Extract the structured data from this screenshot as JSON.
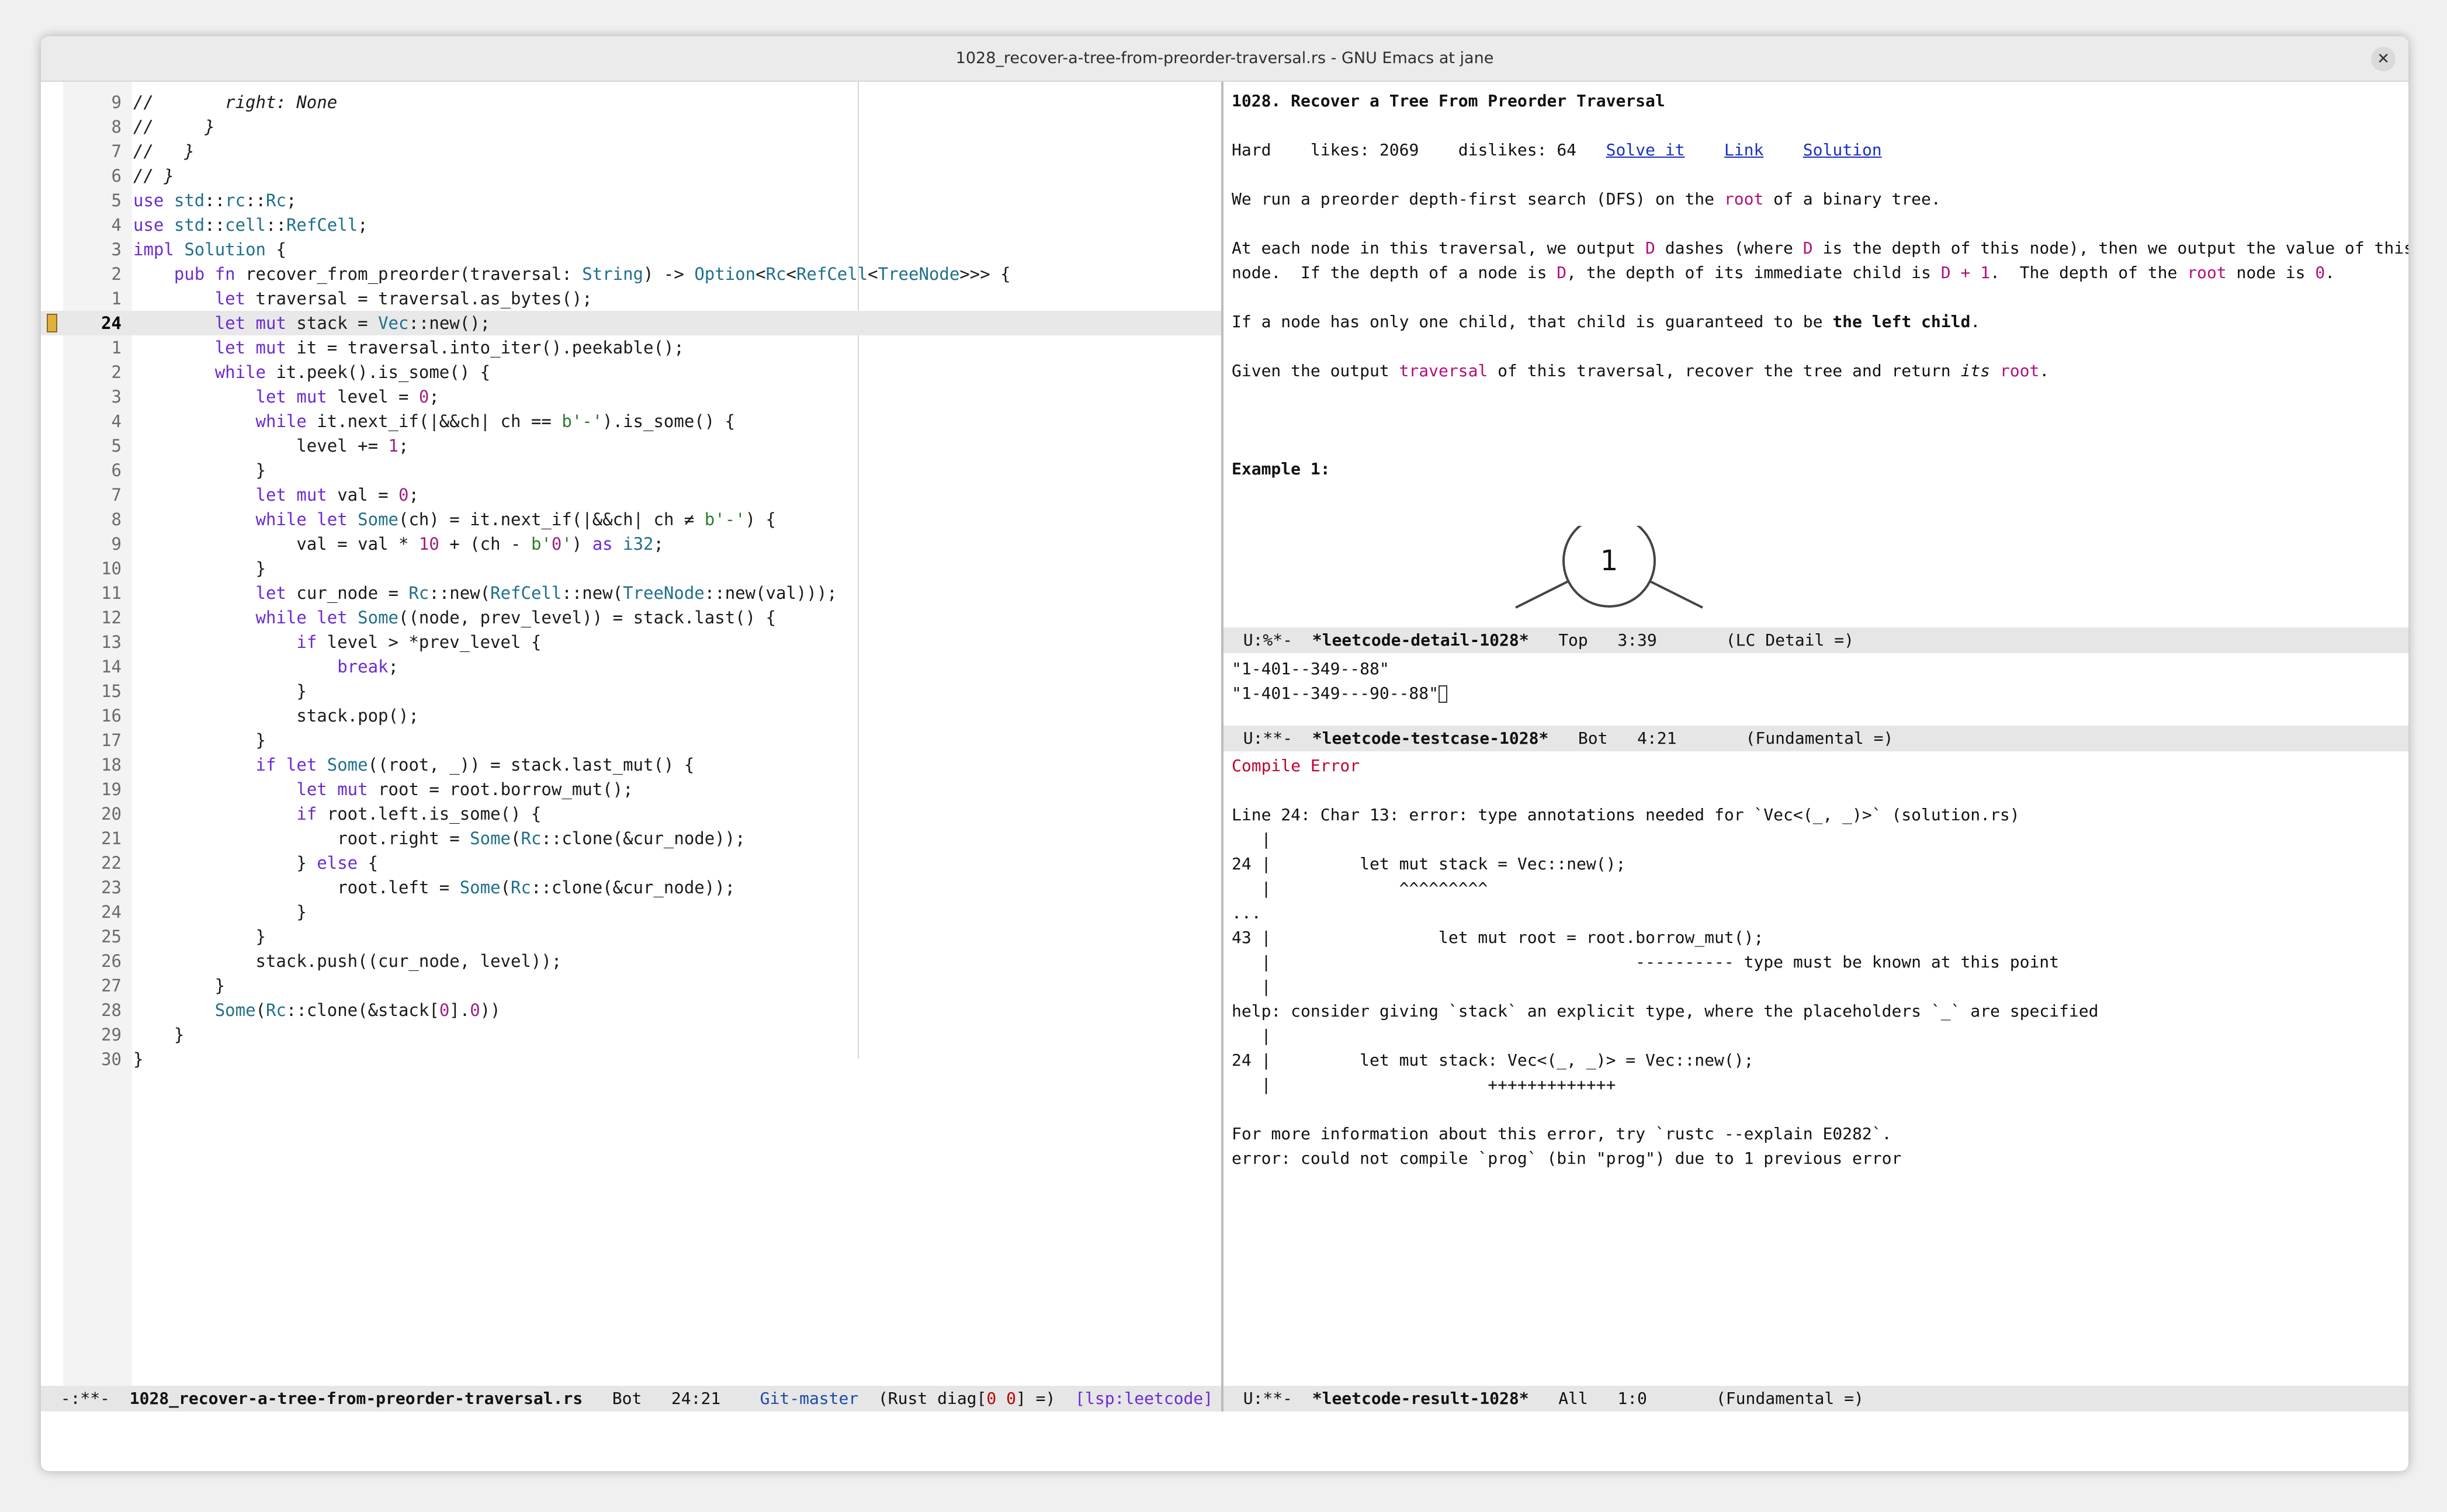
{
  "window": {
    "title": "1028_recover-a-tree-from-preorder-traversal.rs - GNU Emacs at jane",
    "close_glyph": "✕"
  },
  "editor": {
    "lines": [
      {
        "n": "9",
        "t": "//       right: None"
      },
      {
        "n": "8",
        "t": "//     }"
      },
      {
        "n": "7",
        "t": "//   }"
      },
      {
        "n": "6",
        "t": "// }"
      },
      {
        "n": "5",
        "t": "use std::rc::Rc;"
      },
      {
        "n": "4",
        "t": "use std::cell::RefCell;"
      },
      {
        "n": "3",
        "t": "impl Solution {"
      },
      {
        "n": "2",
        "t": "    pub fn recover_from_preorder(traversal: String) -> Option<Rc<RefCell<TreeNode>>> {"
      },
      {
        "n": "1",
        "t": "        let traversal = traversal.as_bytes();"
      },
      {
        "n": "24",
        "t": "        let mut stack = Vec::new();"
      },
      {
        "n": "1",
        "t": "        let mut it = traversal.into_iter().peekable();"
      },
      {
        "n": "2",
        "t": "        while it.peek().is_some() {"
      },
      {
        "n": "3",
        "t": "            let mut level = 0;"
      },
      {
        "n": "4",
        "t": "            while it.next_if(|&&ch| ch == b'-').is_some() {"
      },
      {
        "n": "5",
        "t": "                level += 1;"
      },
      {
        "n": "6",
        "t": "            }"
      },
      {
        "n": "7",
        "t": "            let mut val = 0;"
      },
      {
        "n": "8",
        "t": "            while let Some(ch) = it.next_if(|&&ch| ch ≠ b'-') {"
      },
      {
        "n": "9",
        "t": "                val = val * 10 + (ch - b'0') as i32;"
      },
      {
        "n": "10",
        "t": "            }"
      },
      {
        "n": "11",
        "t": "            let cur_node = Rc::new(RefCell::new(TreeNode::new(val)));"
      },
      {
        "n": "12",
        "t": "            while let Some((node, prev_level)) = stack.last() {"
      },
      {
        "n": "13",
        "t": "                if level > *prev_level {"
      },
      {
        "n": "14",
        "t": "                    break;"
      },
      {
        "n": "15",
        "t": "                }"
      },
      {
        "n": "16",
        "t": "                stack.pop();"
      },
      {
        "n": "17",
        "t": "            }"
      },
      {
        "n": "18",
        "t": "            if let Some((root, _)) = stack.last_mut() {"
      },
      {
        "n": "19",
        "t": "                let mut root = root.borrow_mut();"
      },
      {
        "n": "20",
        "t": "                if root.left.is_some() {"
      },
      {
        "n": "21",
        "t": "                    root.right = Some(Rc::clone(&cur_node));"
      },
      {
        "n": "22",
        "t": "                } else {"
      },
      {
        "n": "23",
        "t": "                    root.left = Some(Rc::clone(&cur_node));"
      },
      {
        "n": "24",
        "t": "                }"
      },
      {
        "n": "25",
        "t": "            }"
      },
      {
        "n": "26",
        "t": "            stack.push((cur_node, level));"
      },
      {
        "n": "27",
        "t": "        }"
      },
      {
        "n": "28",
        "t": "        Some(Rc::clone(&stack[0].0))"
      },
      {
        "n": "29",
        "t": "    }"
      },
      {
        "n": "30",
        "t": "}"
      }
    ],
    "modeline": {
      "status": "-:**-",
      "filename": "1028_recover-a-tree-from-preorder-traversal.rs",
      "pos": "Bot",
      "line_col": "24:21",
      "git": "Git-master",
      "mode_pre": "(Rust diag[",
      "diag_a": "0",
      "diag_b": "0",
      "mode_post": "] =)",
      "lsp": "[lsp:leetcode]"
    }
  },
  "detail": {
    "title": "1028. Recover a Tree From Preorder Traversal",
    "difficulty": "Hard",
    "likes": "likes: 2069",
    "dislikes": "dislikes: 64",
    "solve": "Solve it",
    "link": "Link",
    "solution": "Solution",
    "p1_a": "We run a preorder depth-first search (DFS) on the ",
    "p1_root": "root",
    "p1_b": " of a binary tree.",
    "p2_a": "At each node in this traversal, we output ",
    "p2_d1": "D",
    "p2_b": " dashes (where ",
    "p2_d2": "D",
    "p2_c": " is the depth of this node), then we output the value of this",
    "p3_a": "node.  If the depth of a node is ",
    "p3_d": "D",
    "p3_b": ", the depth of its immediate child is ",
    "p3_d1": "D + 1",
    "p3_c": ".  The depth of the ",
    "p3_root": "root",
    "p3_e": " node is ",
    "p3_zero": "0",
    "p3_f": ".",
    "p4_a": "If a node has only one child, that child is guaranteed to be ",
    "p4_b": "the left child",
    "p4_c": ".",
    "p5_a": "Given the output ",
    "p5_trav": "traversal",
    "p5_b": " of this traversal, recover the tree and return ",
    "p5_its": "its",
    "p5_sp": " ",
    "p5_root": "root",
    "p5_c": ".",
    "example": "Example 1:",
    "tree_node": "1",
    "modeline": {
      "status": "U:%*-",
      "name": "*leetcode-detail-1028*",
      "pos": "Top",
      "line_col": "3:39",
      "mode": "(LC Detail =)"
    }
  },
  "testcase": {
    "lines": [
      "\"1-401--349--88\"",
      "\"1-401--349---90--88\""
    ],
    "modeline": {
      "status": "U:**-",
      "name": "*leetcode-testcase-1028*",
      "pos": "Bot",
      "line_col": "4:21",
      "mode": "(Fundamental =)"
    }
  },
  "result": {
    "heading": "Compile Error",
    "lines": [
      "Line 24: Char 13: error: type annotations needed for `Vec<(_, _)>` (solution.rs)",
      "   |",
      "24 |         let mut stack = Vec::new();",
      "   |             ^^^^^^^^^",
      "...",
      "43 |                 let mut root = root.borrow_mut();",
      "   |                                     ---------- type must be known at this point",
      "   |",
      "help: consider giving `stack` an explicit type, where the placeholders `_` are specified",
      "   |",
      "24 |         let mut stack: Vec<(_, _)> = Vec::new();",
      "   |                      +++++++++++++",
      "",
      "For more information about this error, try `rustc --explain E0282`.",
      "error: could not compile `prog` (bin \"prog\") due to 1 previous error"
    ],
    "modeline": {
      "status": "U:**-",
      "name": "*leetcode-result-1028*",
      "pos": "All",
      "line_col": "1:0",
      "mode": "(Fundamental =)"
    }
  },
  "colors": {
    "accent": "#6c2bd1",
    "link": "#1a2fbf",
    "highlight": "#f2c94c",
    "error": "#c00030"
  }
}
